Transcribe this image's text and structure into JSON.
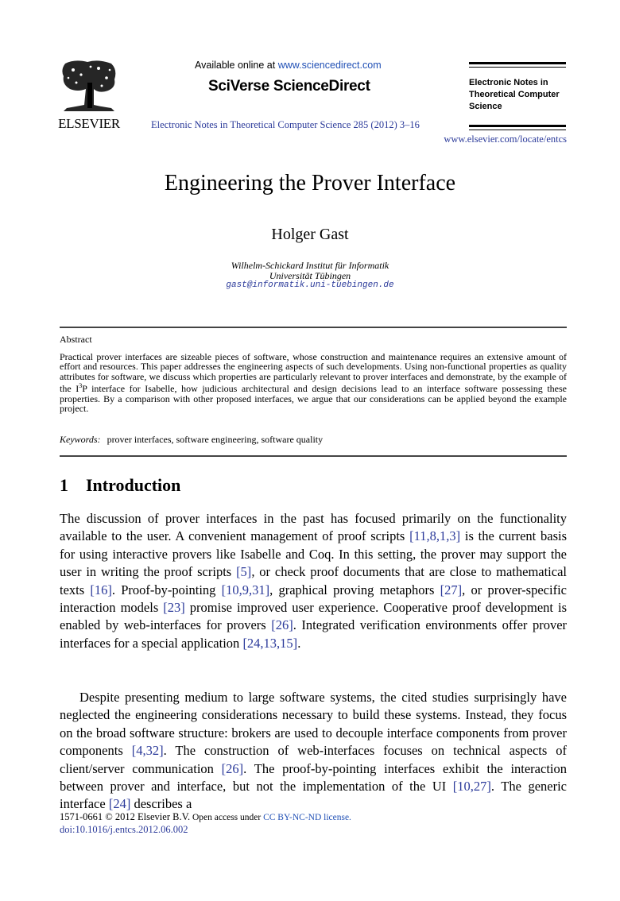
{
  "header": {
    "publisher_logo_text": "ELSEVIER",
    "available_prefix": "Available online at ",
    "available_link": "www.sciencedirect.com",
    "brand": "SciVerse ScienceDirect",
    "journal_citation": "Electronic Notes in Theoretical Computer Science 285 (2012) 3–16",
    "journal_title_lines": [
      "Electronic Notes in",
      "Theoretical Computer",
      "Science"
    ],
    "journal_url": "www.elsevier.com/locate/entcs"
  },
  "article": {
    "title": "Engineering the Prover Interface",
    "author": "Holger Gast",
    "affiliation_line1": "Wilhelm-Schickard Institut für Informatik",
    "affiliation_line2": "Universität Tübingen",
    "email": "gast@informatik.uni-tuebingen.de"
  },
  "abstract": {
    "heading": "Abstract",
    "text_before_sup": "Practical prover interfaces are sizeable pieces of software, whose construction and maintenance requires an extensive amount of effort and resources. This paper addresses the engineering aspects of such developments. Using non-functional properties as quality attributes for software, we discuss which properties are particularly relevant to prover interfaces and demonstrate, by the example of the I",
    "sup": "3",
    "text_after_sup": "P interface for Isabelle, how judicious architectural and design decisions lead to an interface software possessing these properties. By a comparison with other proposed interfaces, we argue that our considerations can be applied beyond the example project.",
    "keywords_label": "Keywords:",
    "keywords": "prover interfaces, software engineering, software quality"
  },
  "section": {
    "number": "1",
    "title": "Introduction",
    "paragraphs": [
      [
        {
          "t": "The discussion of prover interfaces in the past has focused primarily on the functionality available to the user. A convenient management of proof scripts "
        },
        {
          "c": "[11,8,1,3]"
        },
        {
          "t": " is the current basis for using interactive provers like Isabelle and Coq. In this setting, the prover may support the user in writing the proof scripts "
        },
        {
          "c": "[5]"
        },
        {
          "t": ", or check proof documents that are close to mathematical texts "
        },
        {
          "c": "[16]"
        },
        {
          "t": ". Proof-by-pointing "
        },
        {
          "c": "[10,9,31]"
        },
        {
          "t": ", graphical proving metaphors "
        },
        {
          "c": "[27]"
        },
        {
          "t": ", or prover-specific interaction models "
        },
        {
          "c": "[23]"
        },
        {
          "t": " promise improved user experience. Cooperative proof development is enabled by web-interfaces for provers "
        },
        {
          "c": "[26]"
        },
        {
          "t": ". Integrated verification environments offer prover interfaces for a special application "
        },
        {
          "c": "[24,13,15]"
        },
        {
          "t": "."
        }
      ],
      [
        {
          "t": "Despite presenting medium to large software systems, the cited studies surprisingly have neglected the engineering considerations necessary to build these systems. Instead, they focus on the broad software structure: brokers are used to decouple interface components from prover components "
        },
        {
          "c": "[4,32]"
        },
        {
          "t": ". The construction of web-interfaces focuses on technical aspects of client/server communication "
        },
        {
          "c": "[26]"
        },
        {
          "t": ". The proof-by-pointing interfaces exhibit the interaction between prover and interface, but not the implementation of the UI "
        },
        {
          "c": "[10,27]"
        },
        {
          "t": ". The generic interface "
        },
        {
          "c": "[24]"
        },
        {
          "t": " describes a"
        }
      ]
    ]
  },
  "footer": {
    "issn_copyright": "1571-0661 © 2012 Elsevier B.V.",
    "open_access_prefix": " Open access under ",
    "license_link": "CC BY-NC-ND license.",
    "doi": "doi:10.1016/j.entcs.2012.06.002"
  },
  "colors": {
    "link": "#2b3a9a",
    "bright_link": "#1f4fb5",
    "text": "#000000"
  }
}
